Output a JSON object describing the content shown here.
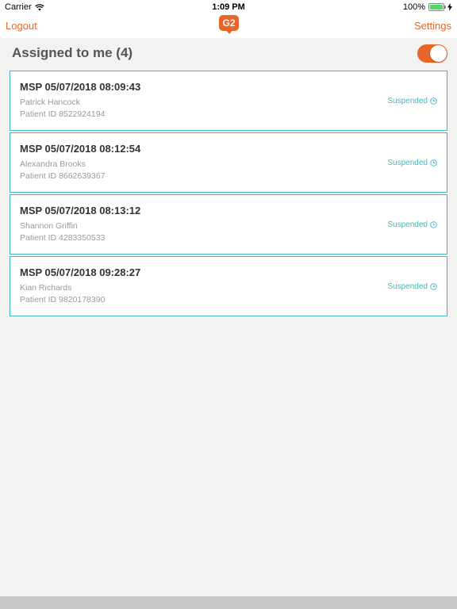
{
  "status_bar": {
    "carrier": "Carrier",
    "time": "1:09 PM",
    "battery": "100%"
  },
  "nav": {
    "logout_label": "Logout",
    "logo_text": "G2",
    "settings_label": "Settings"
  },
  "header": {
    "title": "Assigned to me (4)",
    "toggle_on": true
  },
  "colors": {
    "accent": "#e8662a",
    "teal": "#3fb7c2"
  },
  "cases": [
    {
      "title": "MSP 05/07/2018 08:09:43",
      "name": "Patrick Hancock",
      "patient_id": "Patient ID 8522924194",
      "status": "Suspended"
    },
    {
      "title": "MSP 05/07/2018 08:12:54",
      "name": "Alexandra Brooks",
      "patient_id": "Patient ID 8662639367",
      "status": "Suspended"
    },
    {
      "title": "MSP 05/07/2018 08:13:12",
      "name": "Shannon Griffin",
      "patient_id": "Patient ID 4283350533",
      "status": "Suspended"
    },
    {
      "title": "MSP 05/07/2018 09:28:27",
      "name": "Kian Richards",
      "patient_id": "Patient ID 9820178390",
      "status": "Suspended"
    }
  ]
}
